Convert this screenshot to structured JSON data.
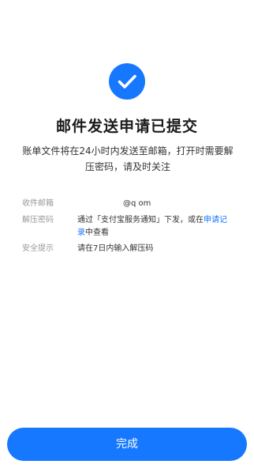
{
  "status": {
    "icon": "check-icon",
    "accent_color": "#1677ff",
    "title": "邮件发送申请已提交",
    "description": "账单文件将在24小时内发送至邮箱，打开时需要解压密码，请及时关注"
  },
  "details": {
    "email_label": "收件邮箱",
    "email_value": "@q om",
    "password_label": "解压密码",
    "password_text_before": "通过「支付宝服务通知」下发，或在",
    "password_link": "申请记录",
    "password_text_after": "中查看",
    "tip_label": "安全提示",
    "tip_value": "请在7日内输入解压码"
  },
  "footer": {
    "done_label": "完成"
  }
}
